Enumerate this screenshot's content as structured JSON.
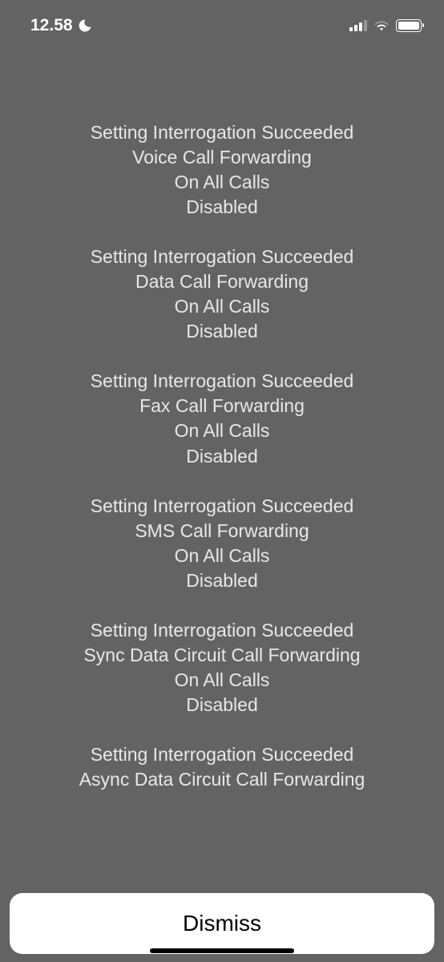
{
  "status": {
    "time": "12.58"
  },
  "blocks": [
    {
      "line1": "Setting Interrogation Succeeded",
      "line2": "Voice Call Forwarding",
      "line3": "On All Calls",
      "line4": "Disabled"
    },
    {
      "line1": "Setting Interrogation Succeeded",
      "line2": "Data Call Forwarding",
      "line3": "On All Calls",
      "line4": "Disabled"
    },
    {
      "line1": "Setting Interrogation Succeeded",
      "line2": "Fax Call Forwarding",
      "line3": "On All Calls",
      "line4": "Disabled"
    },
    {
      "line1": "Setting Interrogation Succeeded",
      "line2": "SMS Call Forwarding",
      "line3": "On All Calls",
      "line4": "Disabled"
    },
    {
      "line1": "Setting Interrogation Succeeded",
      "line2": "Sync Data Circuit Call Forwarding",
      "line3": "On All Calls",
      "line4": "Disabled"
    },
    {
      "line1": "Setting Interrogation Succeeded",
      "line2": "Async Data Circuit Call Forwarding",
      "line3": "",
      "line4": ""
    }
  ],
  "dismiss": {
    "label": "Dismiss"
  }
}
